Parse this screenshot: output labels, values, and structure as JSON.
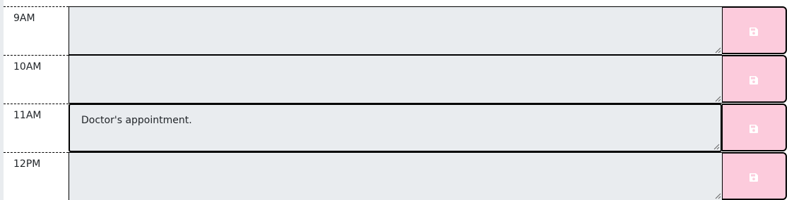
{
  "rows": [
    {
      "hour": "9AM",
      "entry": "",
      "save_icon": "floppy-disk-icon"
    },
    {
      "hour": "10AM",
      "entry": "",
      "save_icon": "floppy-disk-icon"
    },
    {
      "hour": "11AM",
      "entry": "Doctor's appointment.",
      "save_icon": "floppy-disk-icon"
    },
    {
      "hour": "12PM",
      "entry": "",
      "save_icon": "floppy-disk-icon"
    }
  ],
  "colors": {
    "slot_background": "#e9ecef",
    "save_button": "#fccbdc",
    "save_icon": "#ffffff",
    "border": "#000000"
  }
}
